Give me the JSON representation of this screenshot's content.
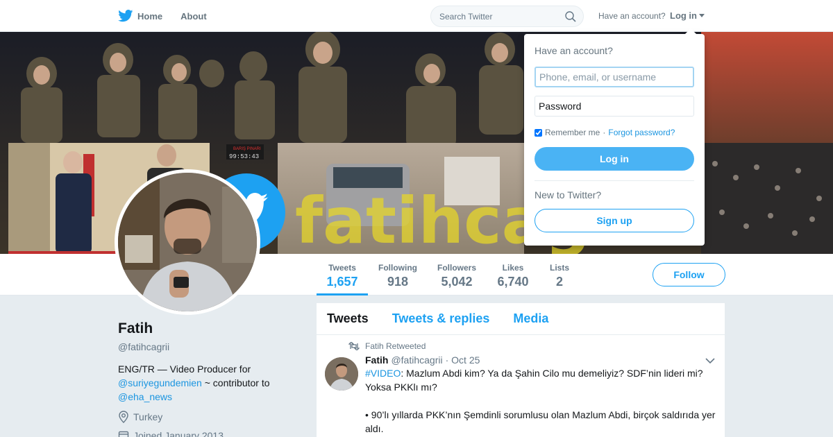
{
  "nav": {
    "home_label": "Home",
    "about_label": "About",
    "search_placeholder": "Search Twitter",
    "have_account": "Have an account?",
    "login_label": "Log in"
  },
  "banner": {
    "overlay_text": "fatihcag",
    "sign_text": "BARIŞ PINARI",
    "clock_text": "99:53:43"
  },
  "profile": {
    "name": "Fatih",
    "handle": "@fatihcagrii",
    "bio_prefix": "ENG/TR — Video Producer for",
    "bio_link1": "@suriyegundemien",
    "bio_middle": "~ contributor to",
    "bio_link2": "@eha_news",
    "location": "Turkey",
    "joined": "Joined January 2013"
  },
  "stats": [
    {
      "label": "Tweets",
      "value": "1,657"
    },
    {
      "label": "Following",
      "value": "918"
    },
    {
      "label": "Followers",
      "value": "5,042"
    },
    {
      "label": "Likes",
      "value": "6,740"
    },
    {
      "label": "Lists",
      "value": "2"
    }
  ],
  "follow_label": "Follow",
  "timeline": {
    "tabs": [
      "Tweets",
      "Tweets & replies",
      "Media"
    ],
    "tweet": {
      "retweet_note": "Fatih Retweeted",
      "name": "Fatih",
      "handle": "@fatihcagrii",
      "date": "· Oct 25",
      "hashtag": "#VIDEO",
      "line1": ": Mazlum Abdi kim? Ya da Şahin Cilo mu demeliyiz? SDF’nin lideri mi? Yoksa PKKlı mı?",
      "line2": "• 90’lı yıllarda PKK’nın Şemdinli sorumlusu olan Mazlum Abdi, birçok saldırıda yer aldı."
    }
  },
  "login_dropdown": {
    "title": "Have an account?",
    "username_placeholder": "Phone, email, or username",
    "password_placeholder": "Password",
    "remember_label": "Remember me",
    "separator": "·",
    "forgot_label": "Forgot password?",
    "login_button": "Log in",
    "new_prompt": "New to Twitter?",
    "signup_button": "Sign up"
  },
  "colors": {
    "brand_blue": "#1da1f2",
    "link_blue": "#1b95e0",
    "background": "#e6ecf0"
  }
}
